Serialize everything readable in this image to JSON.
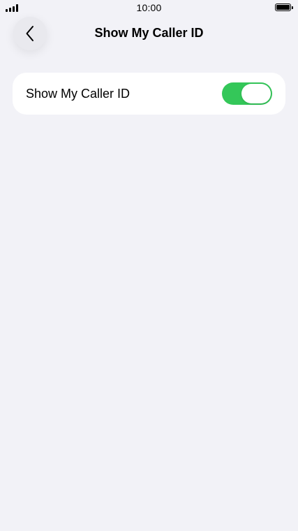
{
  "status_bar": {
    "time": "10:00",
    "signal_icon": "signal-bars-icon",
    "battery_icon": "battery-full-icon"
  },
  "nav": {
    "title": "Show My Caller ID",
    "back_icon": "chevron-left-icon"
  },
  "settings": {
    "show_caller_id": {
      "label": "Show My Caller ID",
      "state": "on"
    }
  },
  "colors": {
    "background": "#f2f2f7",
    "toggle_on": "#34c759"
  }
}
